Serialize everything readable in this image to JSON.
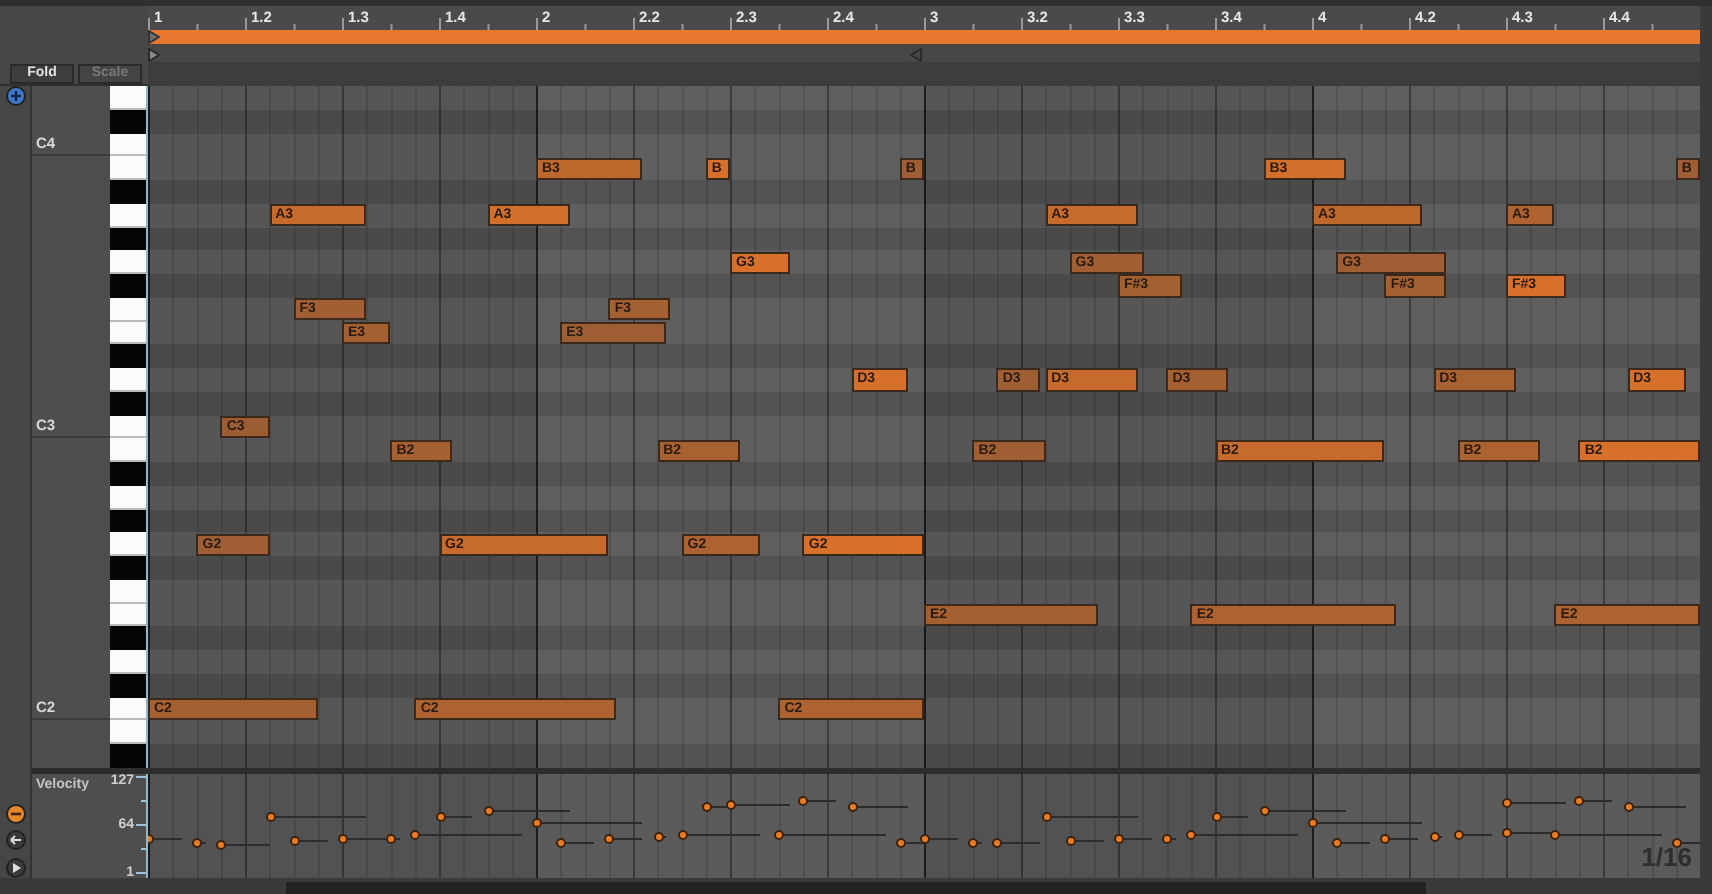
{
  "ruler": {
    "labels": [
      "1",
      "1.2",
      "1.3",
      "1.4",
      "2",
      "2.2",
      "2.3",
      "2.4",
      "3",
      "3.2",
      "3.3",
      "3.4",
      "4",
      "4.2",
      "4.3",
      "4.4"
    ]
  },
  "loop": {
    "on": true
  },
  "fold_button": {
    "label": "Fold"
  },
  "scale_button": {
    "label": "Scale",
    "disabled": true
  },
  "preview_button": {
    "on": true
  },
  "octave_labels": [
    "C4",
    "C3",
    "C2"
  ],
  "notes": [
    {
      "label": "C2"
    },
    {
      "label": "G2"
    },
    {
      "label": "C3"
    },
    {
      "label": "A3"
    },
    {
      "label": "F3"
    },
    {
      "label": "E3"
    },
    {
      "label": "B2"
    },
    {
      "label": "C2"
    },
    {
      "label": "G2"
    },
    {
      "label": "A3"
    },
    {
      "label": "B3"
    },
    {
      "label": "E3"
    },
    {
      "label": "F3"
    },
    {
      "label": "B2"
    },
    {
      "label": "G2"
    },
    {
      "label": "B"
    },
    {
      "label": "G3"
    },
    {
      "label": "C2"
    },
    {
      "label": "G2"
    },
    {
      "label": "D3"
    },
    {
      "label": "B"
    },
    {
      "label": "E2"
    },
    {
      "label": "B2"
    },
    {
      "label": "D3"
    },
    {
      "label": "A3"
    },
    {
      "label": "D3"
    },
    {
      "label": "G3"
    },
    {
      "label": "F#3"
    },
    {
      "label": "D3"
    },
    {
      "label": "E2"
    },
    {
      "label": "B2"
    },
    {
      "label": "B3"
    },
    {
      "label": "A3"
    },
    {
      "label": "G3"
    },
    {
      "label": "F#3"
    },
    {
      "label": "D3"
    },
    {
      "label": "B2"
    },
    {
      "label": "A3"
    },
    {
      "label": "F#3"
    },
    {
      "label": "E2"
    },
    {
      "label": "B2"
    },
    {
      "label": "D3"
    },
    {
      "label": "B"
    }
  ],
  "velocity_lane": {
    "title": "Velocity",
    "scale": [
      "127",
      "64",
      "1"
    ],
    "buttons": [
      {
        "on": true
      },
      {
        "on": false
      },
      {
        "on": false
      }
    ]
  },
  "grid_label": "1/16"
}
